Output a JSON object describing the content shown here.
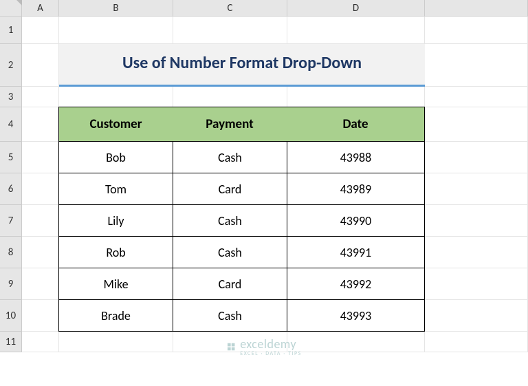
{
  "columns": [
    "A",
    "B",
    "C",
    "D"
  ],
  "rows": [
    "1",
    "2",
    "3",
    "4",
    "5",
    "6",
    "7",
    "8",
    "9",
    "10",
    "11"
  ],
  "title": "Use of Number Format Drop-Down",
  "headers": {
    "customer": "Customer",
    "payment": "Payment",
    "date": "Date"
  },
  "data": [
    {
      "customer": "Bob",
      "payment": "Cash",
      "date": "43988"
    },
    {
      "customer": "Tom",
      "payment": "Card",
      "date": "43989"
    },
    {
      "customer": "Lily",
      "payment": "Cash",
      "date": "43990"
    },
    {
      "customer": "Rob",
      "payment": "Cash",
      "date": "43991"
    },
    {
      "customer": "Mike",
      "payment": "Card",
      "date": "43992"
    },
    {
      "customer": "Brade",
      "payment": "Cash",
      "date": "43993"
    }
  ],
  "watermark": {
    "brand": "exceldemy",
    "tagline": "EXCEL · DATA · TIPS"
  },
  "chart_data": {
    "type": "table",
    "title": "Use of Number Format Drop-Down",
    "columns": [
      "Customer",
      "Payment",
      "Date"
    ],
    "rows": [
      [
        "Bob",
        "Cash",
        43988
      ],
      [
        "Tom",
        "Card",
        43989
      ],
      [
        "Lily",
        "Cash",
        43990
      ],
      [
        "Rob",
        "Cash",
        43991
      ],
      [
        "Mike",
        "Card",
        43992
      ],
      [
        "Brade",
        "Cash",
        43993
      ]
    ]
  }
}
